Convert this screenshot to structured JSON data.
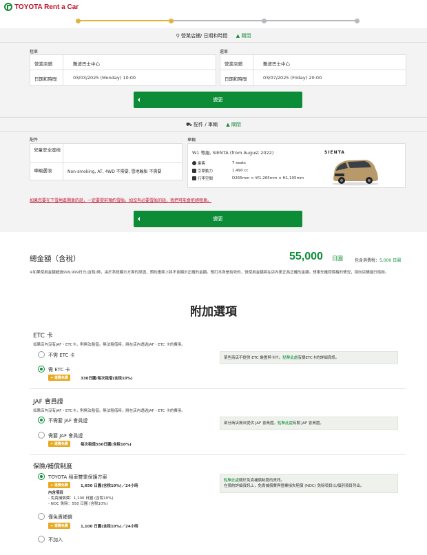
{
  "brand": {
    "name": "TOYOTA Rent a Car"
  },
  "progress": {
    "colors": {
      "done": "#e0b43c",
      "todo": "#b5b8bd"
    }
  },
  "store_section": {
    "title": "營業店鋪/ 日期和時間",
    "toggle": "關閉"
  },
  "pickup": {
    "label": "租車",
    "store_key": "營業店鋪",
    "store_val": "難波巴士中心",
    "time_key": "日期和時間",
    "time_val": "03/03/2025 (Monday) 10:00"
  },
  "return": {
    "label": "還車",
    "store_key": "營業店鋪",
    "store_val": "難波巴士中心",
    "time_key": "日期和時間",
    "time_val": "03/07/2025 (Friday) 20:00"
  },
  "change_button": "變更",
  "parts_section": {
    "title": "配件 / 車輛",
    "toggle": "關閉"
  },
  "parts": {
    "label": "配件",
    "child_seat_key": "兒童安全座椅",
    "child_seat_val": "",
    "vehicle_opt_key": "車輛選項",
    "vehicle_opt_val": "Non-smoking, AT, 4WD  不需要, 雪地輪胎  不需要"
  },
  "vehicle": {
    "label": "車輛",
    "title": "W1 等級, SIENTA (from August 2022)",
    "car_name": "SIENTA",
    "specs": [
      {
        "icon": "person-icon",
        "k": "乘客",
        "v": "7 seats"
      },
      {
        "icon": "engine-icon",
        "k": "引擎動力",
        "v": "1,490 cc"
      },
      {
        "icon": "luggage-icon",
        "k": "行李空間",
        "v": "D265mm × W1,265mm × H1,105mm"
      }
    ]
  },
  "warning_link": "如果您要在下雪地區開車的話，一定要提前預約雪胎。如沒有必要雪胎的話，我們可能會拒絕租車。",
  "total": {
    "label": "總金額（含稅）",
    "price": "55,000",
    "unit": "日圓",
    "tax_label": "包含消費稅：",
    "tax_value": "5,000 日圓"
  },
  "total_note": "※如果使用金額超過999,999日元(含稅)時，由於系統顯示方面的原因，預約畫面上將不會顯示正確的金額。預訂本身是有效的，但使用金額將在店內更正為正確的金額。想事先確認價格的情況，請向店鋪進行諮詢。",
  "addons_title": "附加選項",
  "etc": {
    "title": "ETC 卡",
    "desc": "如果店內沒有JAF・ETC卡，則無法租借。無法租借時，將在店內透過JAF・ETC 卡的費用。",
    "opt1": "不需 ETC 卡",
    "opt2": "需 ETC 卡",
    "badge": "+ 運費免費",
    "price": "330日圓/每次租借(含稅10%)",
    "info_a": "某些商店不提供 ETC 裝置與卡片。",
    "info_link": "點擊此處",
    "info_b": "有關ETC卡的詳細資訊。"
  },
  "jaf": {
    "title": "JAF 會員證",
    "desc": "如果店內沒有JAF・ETC卡，則無法租借。無法租借時，將在店內透過JAF・ETC 卡的費用。",
    "opt1": "不需要 JAF 會員證",
    "opt2": "需要 JAF 會員證",
    "badge": "+ 運費免費",
    "price": "每次租借550日圓(含稅10%)",
    "info_a": "部分商店無法提供 JAF 會員證。",
    "info_link": "點擊此處",
    "info_b": "有關 JAF 會員證。"
  },
  "insurance": {
    "title": "保險/補償制度",
    "opt1": "TOYOTA 租車雙重保護方案",
    "badge1": "+ 運費免費",
    "price1": "1,650 日圓(含稅10%)／24小時",
    "contents_label": "內含項目",
    "item1": "- 免責補償費：1,100 日圓 (含稅10%)",
    "item2": "- NOC 免除：550 日圓 (含稅10%)",
    "opt2": "僅免責補償",
    "badge2": "+ 運費免費",
    "price2": "1,100 日圓(含稅10%)／24小時",
    "opt3": "不加入",
    "info_link": "點擊此處",
    "info_a": "關於免責補償制度的資訊。",
    "info_b": "在預約詳細資訊上，免責補償費與營業損失賠償 (NOC) 免除項目以/個別項目列出。"
  }
}
